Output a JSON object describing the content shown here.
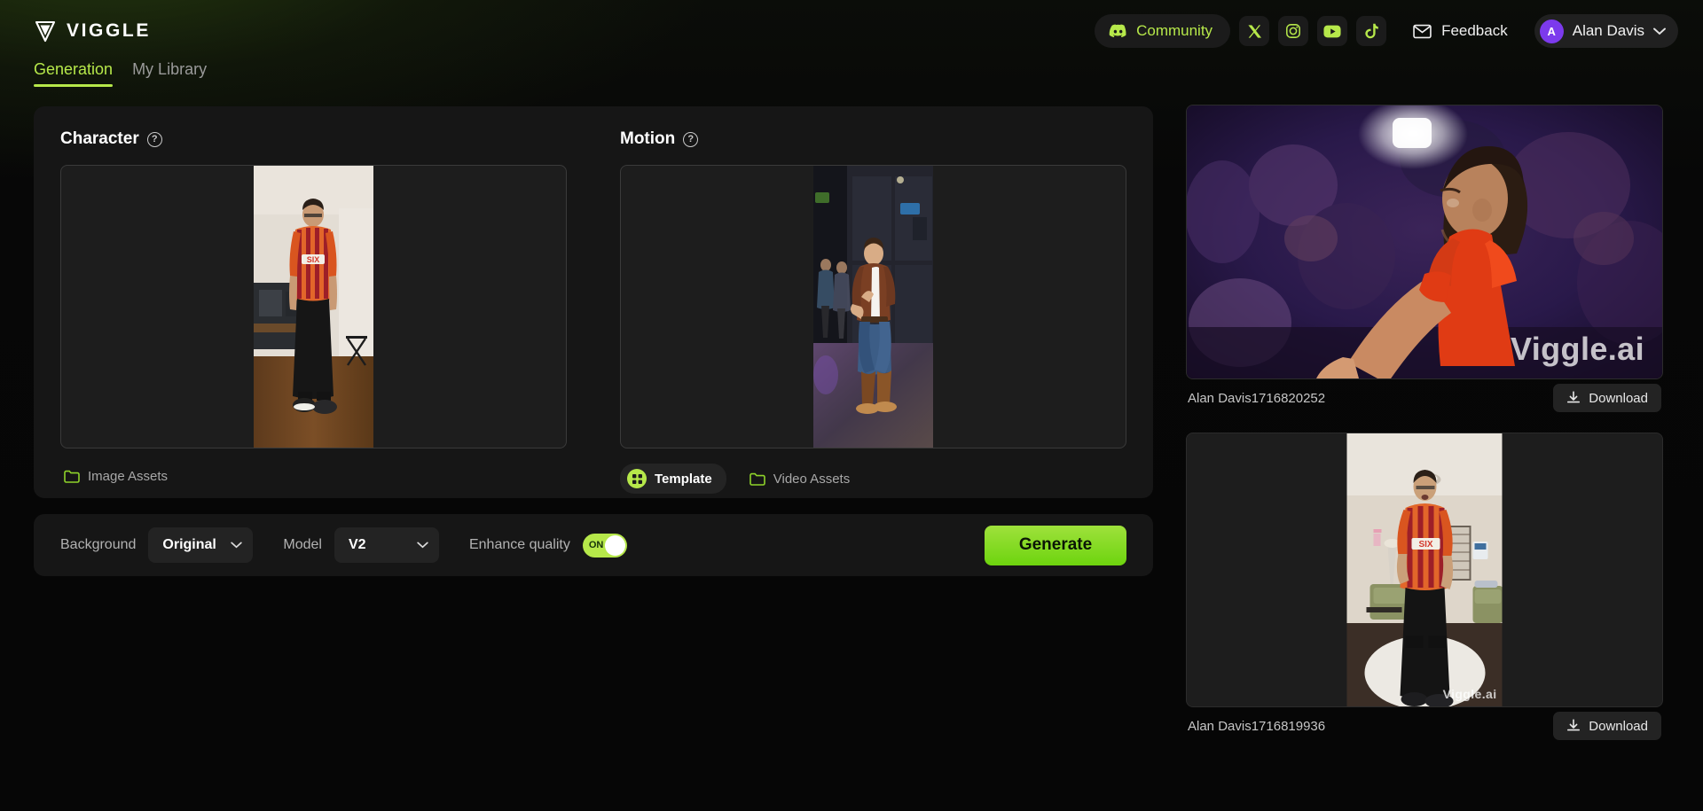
{
  "brand": {
    "name": "VIGGLE",
    "logo_icon": "viggle-v-logo"
  },
  "header": {
    "community_label": "Community",
    "community_icon": "discord-icon",
    "socials": [
      {
        "name": "x-twitter-icon",
        "label": "X"
      },
      {
        "name": "instagram-icon",
        "label": "Instagram"
      },
      {
        "name": "youtube-icon",
        "label": "YouTube"
      },
      {
        "name": "tiktok-icon",
        "label": "TikTok"
      }
    ],
    "feedback_label": "Feedback",
    "feedback_icon": "mail-icon",
    "user": {
      "name": "Alan Davis",
      "initial": "A",
      "chevron_icon": "chevron-down-icon"
    }
  },
  "tabs": [
    {
      "label": "Generation",
      "active": true
    },
    {
      "label": "My Library",
      "active": false
    }
  ],
  "character": {
    "title": "Character",
    "help_icon": "question-mark-icon",
    "assets_label": "Image Assets",
    "assets_icon": "folder-icon"
  },
  "motion": {
    "title": "Motion",
    "help_icon": "question-mark-icon",
    "template_label": "Template",
    "template_icon": "template-grid-icon",
    "video_assets_label": "Video Assets",
    "video_assets_icon": "folder-icon"
  },
  "settings": {
    "background_label": "Background",
    "background_value": "Original",
    "model_label": "Model",
    "model_value": "V2",
    "enhance_label": "Enhance quality",
    "enhance_state": "ON",
    "generate_label": "Generate"
  },
  "results": [
    {
      "name": "Alan Davis1716820252",
      "download_label": "Download",
      "download_icon": "download-icon",
      "watermark": "Viggle.ai"
    },
    {
      "name": "Alan Davis1716819936",
      "download_label": "Download",
      "download_icon": "download-icon",
      "watermark": "Viggle.ai"
    }
  ],
  "colors": {
    "accent": "#b6e84a",
    "generate_green": "#7fd920",
    "panel": "#161616",
    "background": "#070707",
    "avatar_purple": "#7c3aed"
  }
}
